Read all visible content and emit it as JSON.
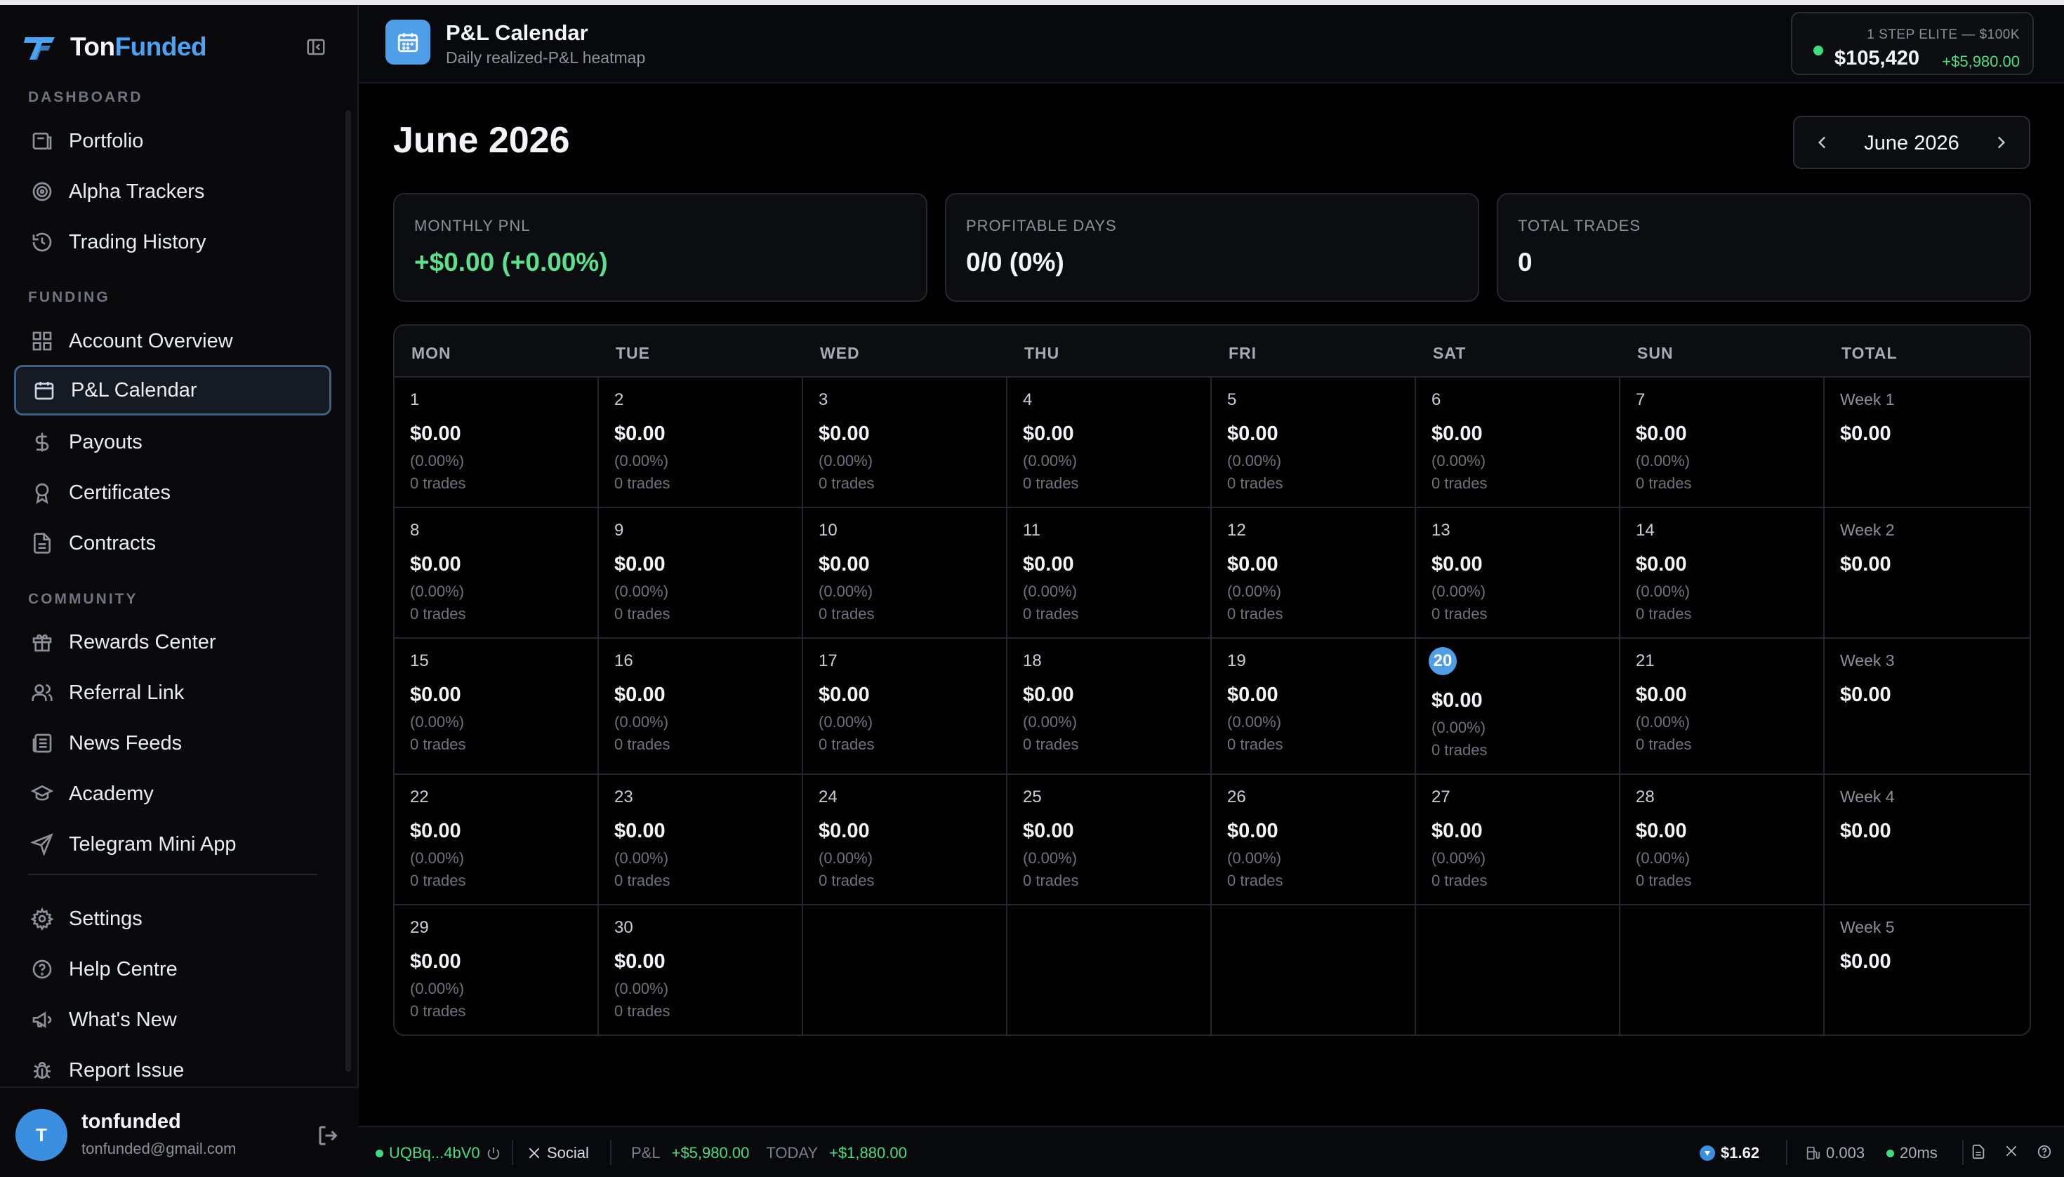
{
  "brand": {
    "name_part1": "Ton",
    "name_part2": "Funded"
  },
  "sidebar": {
    "sections": [
      {
        "label": "DASHBOARD"
      },
      {
        "label": "FUNDING"
      },
      {
        "label": "COMMUNITY"
      }
    ],
    "items": [
      {
        "label": "Portfolio",
        "icon": "portfolio-icon"
      },
      {
        "label": "Alpha Trackers",
        "icon": "target-icon"
      },
      {
        "label": "Trading History",
        "icon": "history-icon"
      },
      {
        "label": "Account Overview",
        "icon": "grid-icon"
      },
      {
        "label": "P&L Calendar",
        "icon": "calendar-icon",
        "active": true
      },
      {
        "label": "Payouts",
        "icon": "dollar-icon"
      },
      {
        "label": "Certificates",
        "icon": "award-icon"
      },
      {
        "label": "Contracts",
        "icon": "document-icon"
      },
      {
        "label": "Rewards Center",
        "icon": "gift-icon"
      },
      {
        "label": "Referral Link",
        "icon": "users-icon"
      },
      {
        "label": "News Feeds",
        "icon": "newspaper-icon"
      },
      {
        "label": "Academy",
        "icon": "graduation-cap-icon"
      },
      {
        "label": "Telegram Mini App",
        "icon": "send-icon"
      },
      {
        "label": "Settings",
        "icon": "gear-icon"
      },
      {
        "label": "Help Centre",
        "icon": "help-circle-icon"
      },
      {
        "label": "What's New",
        "icon": "megaphone-icon"
      },
      {
        "label": "Report Issue",
        "icon": "bug-icon"
      }
    ]
  },
  "user": {
    "initial": "T",
    "name": "tonfunded",
    "email": "tonfunded@gmail.com"
  },
  "header": {
    "title": "P&L Calendar",
    "subtitle": "Daily realized-P&L heatmap",
    "account": {
      "name": "1 STEP ELITE — $100K",
      "balance": "$105,420",
      "change": "+$5,980.00"
    }
  },
  "main": {
    "month_title": "June 2026",
    "month_selector": "June 2026",
    "stats": [
      {
        "label": "MONTHLY PNL",
        "value": "+$0.00 (+0.00%)",
        "positive": true
      },
      {
        "label": "PROFITABLE DAYS",
        "value": "0/0 (0%)"
      },
      {
        "label": "TOTAL TRADES",
        "value": "0"
      }
    ],
    "weekdays": [
      "MON",
      "TUE",
      "WED",
      "THU",
      "FRI",
      "SAT",
      "SUN",
      "TOTAL"
    ],
    "today": 20,
    "days": [
      {
        "d": "1",
        "amt": "$0.00",
        "pct": "(0.00%)",
        "trades": "0 trades"
      },
      {
        "d": "2",
        "amt": "$0.00",
        "pct": "(0.00%)",
        "trades": "0 trades"
      },
      {
        "d": "3",
        "amt": "$0.00",
        "pct": "(0.00%)",
        "trades": "0 trades"
      },
      {
        "d": "4",
        "amt": "$0.00",
        "pct": "(0.00%)",
        "trades": "0 trades"
      },
      {
        "d": "5",
        "amt": "$0.00",
        "pct": "(0.00%)",
        "trades": "0 trades"
      },
      {
        "d": "6",
        "amt": "$0.00",
        "pct": "(0.00%)",
        "trades": "0 trades"
      },
      {
        "d": "7",
        "amt": "$0.00",
        "pct": "(0.00%)",
        "trades": "0 trades"
      },
      {
        "d": "8",
        "amt": "$0.00",
        "pct": "(0.00%)",
        "trades": "0 trades"
      },
      {
        "d": "9",
        "amt": "$0.00",
        "pct": "(0.00%)",
        "trades": "0 trades"
      },
      {
        "d": "10",
        "amt": "$0.00",
        "pct": "(0.00%)",
        "trades": "0 trades"
      },
      {
        "d": "11",
        "amt": "$0.00",
        "pct": "(0.00%)",
        "trades": "0 trades"
      },
      {
        "d": "12",
        "amt": "$0.00",
        "pct": "(0.00%)",
        "trades": "0 trades"
      },
      {
        "d": "13",
        "amt": "$0.00",
        "pct": "(0.00%)",
        "trades": "0 trades"
      },
      {
        "d": "14",
        "amt": "$0.00",
        "pct": "(0.00%)",
        "trades": "0 trades"
      },
      {
        "d": "15",
        "amt": "$0.00",
        "pct": "(0.00%)",
        "trades": "0 trades"
      },
      {
        "d": "16",
        "amt": "$0.00",
        "pct": "(0.00%)",
        "trades": "0 trades"
      },
      {
        "d": "17",
        "amt": "$0.00",
        "pct": "(0.00%)",
        "trades": "0 trades"
      },
      {
        "d": "18",
        "amt": "$0.00",
        "pct": "(0.00%)",
        "trades": "0 trades"
      },
      {
        "d": "19",
        "amt": "$0.00",
        "pct": "(0.00%)",
        "trades": "0 trades"
      },
      {
        "d": "20",
        "amt": "$0.00",
        "pct": "(0.00%)",
        "trades": "0 trades"
      },
      {
        "d": "21",
        "amt": "$0.00",
        "pct": "(0.00%)",
        "trades": "0 trades"
      },
      {
        "d": "22",
        "amt": "$0.00",
        "pct": "(0.00%)",
        "trades": "0 trades"
      },
      {
        "d": "23",
        "amt": "$0.00",
        "pct": "(0.00%)",
        "trades": "0 trades"
      },
      {
        "d": "24",
        "amt": "$0.00",
        "pct": "(0.00%)",
        "trades": "0 trades"
      },
      {
        "d": "25",
        "amt": "$0.00",
        "pct": "(0.00%)",
        "trades": "0 trades"
      },
      {
        "d": "26",
        "amt": "$0.00",
        "pct": "(0.00%)",
        "trades": "0 trades"
      },
      {
        "d": "27",
        "amt": "$0.00",
        "pct": "(0.00%)",
        "trades": "0 trades"
      },
      {
        "d": "28",
        "amt": "$0.00",
        "pct": "(0.00%)",
        "trades": "0 trades"
      },
      {
        "d": "29",
        "amt": "$0.00",
        "pct": "(0.00%)",
        "trades": "0 trades"
      },
      {
        "d": "30",
        "amt": "$0.00",
        "pct": "(0.00%)",
        "trades": "0 trades"
      }
    ],
    "weeks": [
      {
        "label": "Week 1",
        "amt": "$0.00"
      },
      {
        "label": "Week 2",
        "amt": "$0.00"
      },
      {
        "label": "Week 3",
        "amt": "$0.00"
      },
      {
        "label": "Week 4",
        "amt": "$0.00"
      },
      {
        "label": "Week 5",
        "amt": "$0.00"
      }
    ]
  },
  "statusbar": {
    "wallet": "UQBq...4bV0",
    "social": "Social",
    "pnl_label": "P&L",
    "pnl_value": "+$5,980.00",
    "today_label": "TODAY",
    "today_value": "+$1,880.00",
    "ton_price": "$1.62",
    "gas": "0.003",
    "latency": "20ms"
  },
  "colors": {
    "accent": "#4f9ee8",
    "positive": "#4ade80",
    "background": "#000000"
  }
}
